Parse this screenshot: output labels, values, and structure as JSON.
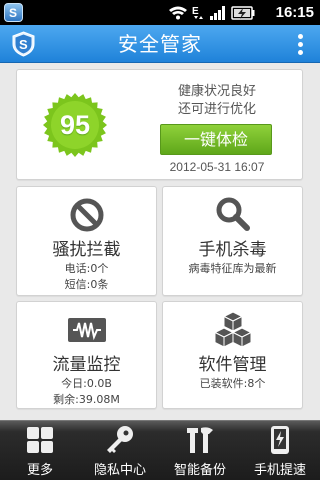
{
  "status_bar": {
    "time": "16:15",
    "icons": [
      "app-icon",
      "wifi-icon",
      "data-e-icon",
      "signal-icon",
      "battery-charging-icon"
    ]
  },
  "header": {
    "title": "安全管家",
    "menu_icon": "overflow-menu-icon"
  },
  "health": {
    "score": "95",
    "status_line1": "健康状况良好",
    "status_line2": "还可进行优化",
    "check_button_label": "一键体检",
    "last_check_time": "2012-05-31 16:07"
  },
  "features": [
    {
      "icon": "block-icon",
      "title": "骚扰拦截",
      "sub1": "电话:0个",
      "sub2": "短信:0条"
    },
    {
      "icon": "magnifier-icon",
      "title": "手机杀毒",
      "sub1": "病毒特征库为最新",
      "sub2": ""
    },
    {
      "icon": "traffic-meter-icon",
      "title": "流量监控",
      "sub1": "今日:0.0B",
      "sub2": "剩余:39.08M"
    },
    {
      "icon": "cubes-icon",
      "title": "软件管理",
      "sub1": "已装软件:8个",
      "sub2": ""
    }
  ],
  "bottom_nav": [
    {
      "icon": "grid-icon",
      "label": "更多"
    },
    {
      "icon": "key-icon",
      "label": "隐私中心"
    },
    {
      "icon": "tools-icon",
      "label": "智能备份"
    },
    {
      "icon": "phone-boost-icon",
      "label": "手机提速"
    }
  ],
  "colors": {
    "title_bar": "#2a8fe0",
    "score_badge": "#7cc51d",
    "check_button": "#6fb926",
    "background": "#e9e9e9",
    "bottom_nav": "#1c1c1c"
  }
}
